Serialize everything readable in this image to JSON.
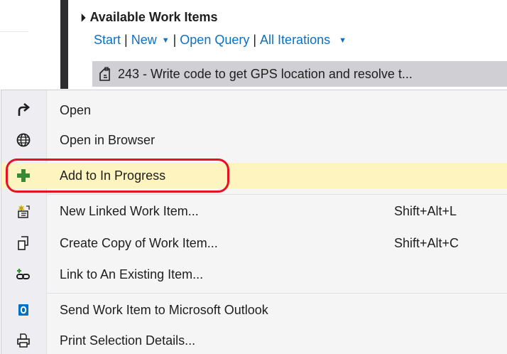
{
  "panel": {
    "section_title": "Available Work Items",
    "links": {
      "start": "Start",
      "new": "New",
      "open_query": "Open Query",
      "all_iterations": "All Iterations"
    },
    "work_item": "243 - Write code to get GPS location and resolve t..."
  },
  "context_menu": {
    "open": "Open",
    "open_in_browser": "Open in Browser",
    "add_to_in_progress": "Add to In Progress",
    "new_linked_work_item": "New Linked Work Item...",
    "new_linked_shortcut": "Shift+Alt+L",
    "create_copy": "Create Copy of Work Item...",
    "create_copy_shortcut": "Shift+Alt+C",
    "link_existing": "Link to An Existing Item...",
    "send_outlook": "Send Work Item to Microsoft Outlook",
    "print_selection": "Print Selection Details..."
  },
  "colors": {
    "link": "#0e70c0",
    "highlight": "#fdf4bf",
    "callout": "#e81123",
    "plus": "#388a34",
    "outlook": "#0072c6"
  },
  "icons": [
    "redo-arrow-icon",
    "globe-icon",
    "plus-icon",
    "new-linked-item-icon",
    "copy-icon",
    "link-item-icon",
    "outlook-icon",
    "print-icon"
  ]
}
